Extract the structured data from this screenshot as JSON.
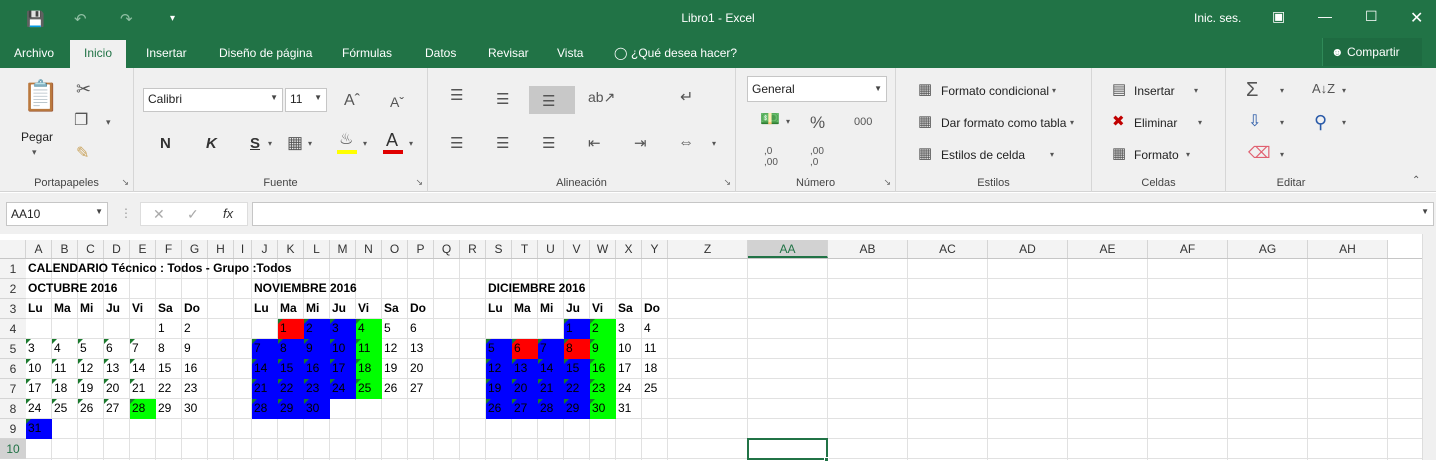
{
  "window": {
    "title": "Libro1 - Excel",
    "sign_in": "Inic. ses."
  },
  "tabs": [
    "Archivo",
    "Inicio",
    "Insertar",
    "Diseño de página",
    "Fórmulas",
    "Datos",
    "Revisar",
    "Vista"
  ],
  "tell_me": "¿Qué desea hacer?",
  "share": "Compartir",
  "ribbon": {
    "clipboard": {
      "label": "Portapapeles",
      "paste": "Pegar"
    },
    "font": {
      "label": "Fuente",
      "name": "Calibri",
      "size": "11",
      "bold": "N",
      "italic": "K",
      "underline": "S"
    },
    "alignment": {
      "label": "Alineación"
    },
    "number": {
      "label": "Número",
      "format": "General",
      "percent": "%",
      "thousands": "000",
      "inc_decimals": ",0\n,00",
      "dec_decimals": ",00\n,0"
    },
    "styles": {
      "label": "Estilos",
      "conditional": "Formato condicional",
      "as_table": "Dar formato como tabla",
      "cell_styles": "Estilos de celda"
    },
    "cells": {
      "label": "Celdas",
      "insert": "Insertar",
      "delete": "Eliminar",
      "format": "Formato"
    },
    "editing": {
      "label": "Editar"
    }
  },
  "formula_bar": {
    "name_box": "AA10",
    "fx": "fx",
    "content": ""
  },
  "sheet": {
    "columns": [
      "A",
      "B",
      "C",
      "D",
      "E",
      "F",
      "G",
      "H",
      "I",
      "J",
      "K",
      "L",
      "M",
      "N",
      "O",
      "P",
      "Q",
      "R",
      "S",
      "T",
      "U",
      "V",
      "W",
      "X",
      "Y",
      "Z",
      "AA",
      "AB",
      "AC",
      "AD",
      "AE",
      "AF",
      "AG",
      "AH"
    ],
    "rows": [
      "1",
      "2",
      "3",
      "4",
      "5",
      "6",
      "7",
      "8",
      "9",
      "10"
    ],
    "selected_cell": "AA10",
    "title": "CALENDARIO Técnico : Todos - Grupo :Todos",
    "day_headers": [
      "Lu",
      "Ma",
      "Mi",
      "Ju",
      "Vi",
      "Sa",
      "Do"
    ],
    "months": [
      {
        "name": "OCTUBRE 2016",
        "col": 0,
        "weeks": [
          [
            "",
            "",
            "",
            "",
            "",
            "1",
            "2"
          ],
          [
            "3",
            "4",
            "5",
            "6",
            "7",
            "8",
            "9"
          ],
          [
            "10",
            "11",
            "12",
            "13",
            "14",
            "15",
            "16"
          ],
          [
            "17",
            "18",
            "19",
            "20",
            "21",
            "22",
            "23"
          ],
          [
            "24",
            "25",
            "26",
            "27",
            "28",
            "29",
            "30"
          ],
          [
            "31",
            "",
            "",
            "",
            "",
            "",
            ""
          ]
        ],
        "blue": [
          "31"
        ],
        "green": [
          "28"
        ],
        "red": [],
        "flag": [
          "3",
          "4",
          "5",
          "6",
          "7",
          "10",
          "11",
          "12",
          "13",
          "14",
          "17",
          "18",
          "19",
          "20",
          "21",
          "24",
          "25",
          "26",
          "27",
          "28",
          "31"
        ]
      },
      {
        "name": "NOVIEMBRE 2016",
        "col": 9,
        "weeks": [
          [
            "",
            "1",
            "2",
            "3",
            "4",
            "5",
            "6"
          ],
          [
            "7",
            "8",
            "9",
            "10",
            "11",
            "12",
            "13"
          ],
          [
            "14",
            "15",
            "16",
            "17",
            "18",
            "19",
            "20"
          ],
          [
            "21",
            "22",
            "23",
            "24",
            "25",
            "26",
            "27"
          ],
          [
            "28",
            "29",
            "30",
            "",
            "",
            "",
            ""
          ]
        ],
        "blue": [
          "2",
          "3",
          "7",
          "8",
          "9",
          "10",
          "14",
          "15",
          "16",
          "17",
          "21",
          "22",
          "23",
          "24",
          "28",
          "29",
          "30"
        ],
        "green": [
          "4",
          "11",
          "18",
          "25"
        ],
        "red": [
          "1"
        ],
        "flag": [
          "1",
          "2",
          "3",
          "4",
          "7",
          "8",
          "9",
          "10",
          "11",
          "14",
          "15",
          "16",
          "17",
          "18",
          "21",
          "22",
          "23",
          "24",
          "25",
          "28",
          "29",
          "30"
        ]
      },
      {
        "name": "DICIEMBRE 2016",
        "col": 18,
        "weeks": [
          [
            "",
            "",
            "",
            "1",
            "2",
            "3",
            "4"
          ],
          [
            "5",
            "6",
            "7",
            "8",
            "9",
            "10",
            "11"
          ],
          [
            "12",
            "13",
            "14",
            "15",
            "16",
            "17",
            "18"
          ],
          [
            "19",
            "20",
            "21",
            "22",
            "23",
            "24",
            "25"
          ],
          [
            "26",
            "27",
            "28",
            "29",
            "30",
            "31",
            ""
          ]
        ],
        "blue": [
          "1",
          "5",
          "7",
          "12",
          "13",
          "14",
          "15",
          "19",
          "20",
          "21",
          "22",
          "26",
          "27",
          "28",
          "29"
        ],
        "green": [
          "2",
          "9",
          "16",
          "23",
          "30"
        ],
        "red": [
          "6",
          "8"
        ],
        "flag": [
          "1",
          "2",
          "5",
          "6",
          "7",
          "8",
          "9",
          "12",
          "13",
          "14",
          "15",
          "16",
          "19",
          "20",
          "21",
          "22",
          "23",
          "26",
          "27",
          "28",
          "29",
          "30"
        ]
      }
    ],
    "colors": {
      "blue": "#0000ff",
      "green": "#00ff00",
      "red": "#ff0000",
      "flag": "#1b7a2d",
      "accent": "#217346"
    }
  }
}
